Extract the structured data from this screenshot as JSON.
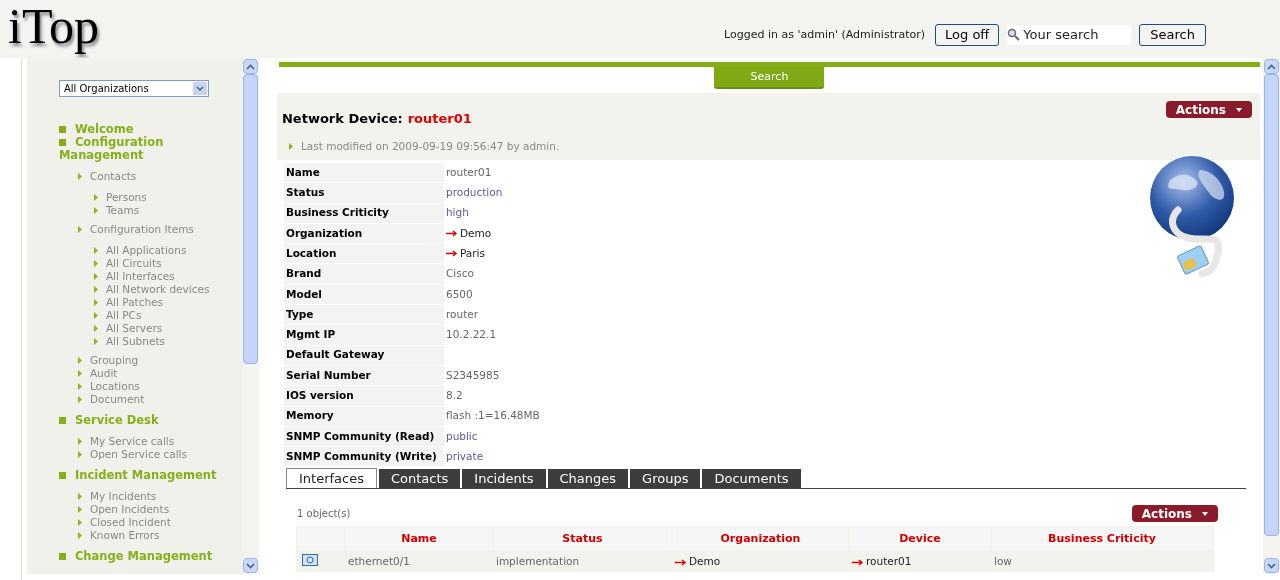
{
  "header": {
    "logo": "iTop",
    "login_text": "Logged in as 'admin' (Administrator)",
    "logoff_button": "Log off",
    "search_placeholder": "Your search",
    "search_button": "Search"
  },
  "sidebar": {
    "org_select": "All Organizations",
    "menus": [
      {
        "label": "Welcome"
      },
      {
        "label": "Configuration Management",
        "children": [
          {
            "label": "Contacts",
            "children": [
              {
                "label": "Persons"
              },
              {
                "label": "Teams"
              }
            ]
          },
          {
            "label": "Configuration Items",
            "children": [
              {
                "label": "All Applications"
              },
              {
                "label": "All Circuits"
              },
              {
                "label": "All Interfaces"
              },
              {
                "label": "All Network devices"
              },
              {
                "label": "All Patches"
              },
              {
                "label": "All PCs"
              },
              {
                "label": "All Servers"
              },
              {
                "label": "All Subnets"
              }
            ]
          },
          {
            "label": "Grouping"
          },
          {
            "label": "Audit"
          },
          {
            "label": "Locations"
          },
          {
            "label": "Document"
          }
        ]
      },
      {
        "label": "Service Desk",
        "children": [
          {
            "label": "My Service calls"
          },
          {
            "label": "Open Service calls"
          }
        ]
      },
      {
        "label": "Incident Management",
        "children": [
          {
            "label": "My Incidents"
          },
          {
            "label": "Open Incidents"
          },
          {
            "label": "Closed Incident"
          },
          {
            "label": "Known Errors"
          }
        ]
      },
      {
        "label": "Change Management"
      }
    ]
  },
  "search_tab": "Search",
  "details": {
    "class_label": "Network Device:",
    "object_name": "router01",
    "actions": "Actions",
    "last_modified": "Last modified on 2009-09-19 09:56:47 by admin.",
    "fields": [
      {
        "label": "Name",
        "value": "router01",
        "kind": "text"
      },
      {
        "label": "Status",
        "value": "production",
        "kind": "enum"
      },
      {
        "label": "Business Criticity",
        "value": "high",
        "kind": "enum"
      },
      {
        "label": "Organization",
        "value": "Demo",
        "kind": "link"
      },
      {
        "label": "Location",
        "value": "Paris",
        "kind": "link"
      },
      {
        "label": "Brand",
        "value": "Cisco",
        "kind": "text"
      },
      {
        "label": "Model",
        "value": "6500",
        "kind": "text"
      },
      {
        "label": "Type",
        "value": "router",
        "kind": "text"
      },
      {
        "label": "Mgmt IP",
        "value": "10.2.22.1",
        "kind": "text"
      },
      {
        "label": "Default Gateway"
      },
      {
        "label": "Serial Number",
        "value": "S2345985",
        "kind": "text"
      },
      {
        "label": "IOS version",
        "value": "8.2",
        "kind": "text"
      },
      {
        "label": "Memory",
        "value": "flash :1=16.48MB",
        "kind": "text"
      },
      {
        "label": "SNMP Community (Read)",
        "value": "public",
        "kind": "enum"
      },
      {
        "label": "SNMP Community (Write)",
        "value": "private",
        "kind": "enum"
      }
    ]
  },
  "tabs": [
    {
      "label": "Interfaces",
      "selected": true
    },
    {
      "label": "Contacts",
      "selected": false
    },
    {
      "label": "Incidents",
      "selected": false
    },
    {
      "label": "Changes",
      "selected": false
    },
    {
      "label": "Groups",
      "selected": false
    },
    {
      "label": "Documents",
      "selected": false
    }
  ],
  "list": {
    "count": "1 object(s)",
    "actions": "Actions",
    "columns": [
      "Name",
      "Status",
      "Organization",
      "Device",
      "Business Criticity"
    ],
    "rows": [
      [
        {
          "value": "ethernet0/1",
          "kind": "text"
        },
        {
          "value": "implementation",
          "kind": "text"
        },
        {
          "value": "Demo",
          "kind": "link"
        },
        {
          "value": "router01",
          "kind": "link"
        },
        {
          "value": "low",
          "kind": "text"
        }
      ]
    ]
  }
}
